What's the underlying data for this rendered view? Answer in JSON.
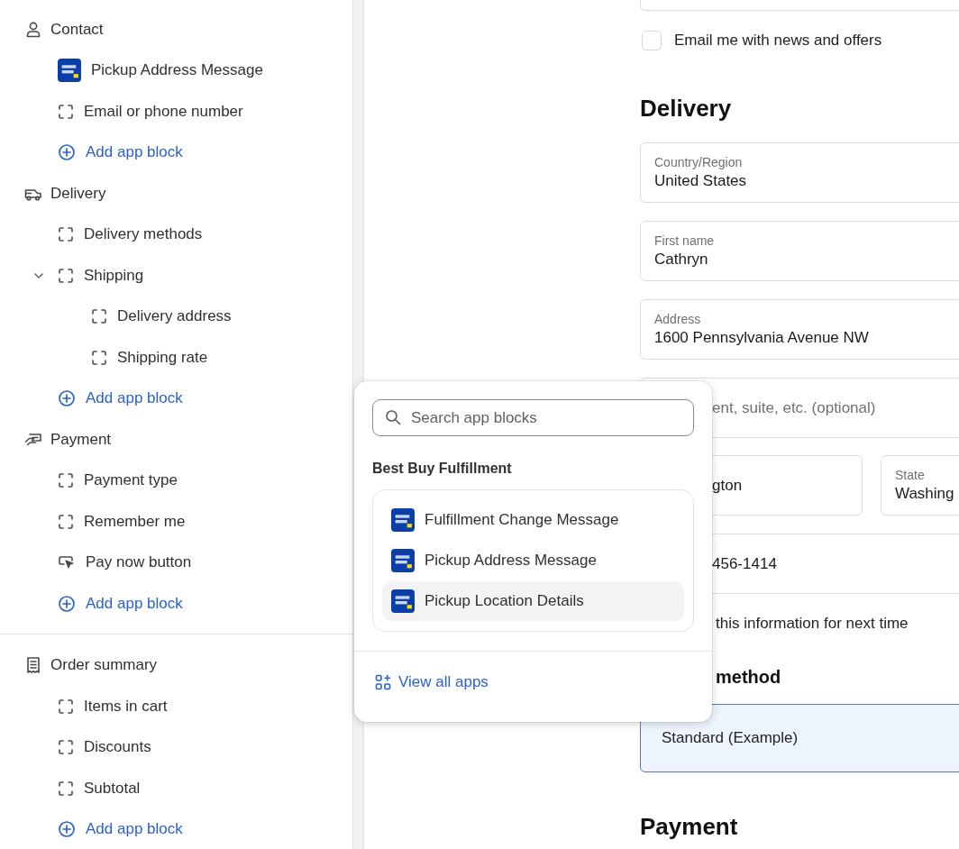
{
  "sidebar": {
    "groups": [
      {
        "sections": [
          {
            "label": "Contact",
            "children": [
              {
                "kind": "app",
                "label": "Pickup Address Message"
              },
              {
                "kind": "block",
                "label": "Email or phone number"
              },
              {
                "kind": "add",
                "label": "Add app block"
              }
            ]
          },
          {
            "label": "Delivery",
            "children": [
              {
                "kind": "block",
                "label": "Delivery methods"
              },
              {
                "kind": "block",
                "label": "Shipping",
                "expanded": true,
                "children": [
                  {
                    "kind": "block",
                    "label": "Delivery address"
                  },
                  {
                    "kind": "block",
                    "label": "Shipping rate"
                  }
                ]
              },
              {
                "kind": "add",
                "label": "Add app block"
              }
            ]
          },
          {
            "label": "Payment",
            "children": [
              {
                "kind": "block",
                "label": "Payment type"
              },
              {
                "kind": "block",
                "label": "Remember me"
              },
              {
                "kind": "button",
                "label": "Pay now button"
              },
              {
                "kind": "add",
                "label": "Add app block"
              }
            ]
          }
        ]
      },
      {
        "sections": [
          {
            "label": "Order summary",
            "children": [
              {
                "kind": "block",
                "label": "Items in cart"
              },
              {
                "kind": "block",
                "label": "Discounts"
              },
              {
                "kind": "block",
                "label": "Subtotal"
              },
              {
                "kind": "add",
                "label": "Add app block"
              }
            ]
          }
        ]
      }
    ]
  },
  "preview": {
    "items": [
      {
        "kind": "field-edge"
      },
      {
        "kind": "checkbox",
        "label": "Email me with news and offers",
        "checked": false
      },
      {
        "kind": "heading",
        "text": "Delivery"
      },
      {
        "kind": "field",
        "label": "Country/Region",
        "value": "United States"
      },
      {
        "kind": "field",
        "label": "First name",
        "value": "Cathryn"
      },
      {
        "kind": "field",
        "label": "Address",
        "value": "1600 Pennsylvania Avenue NW"
      },
      {
        "kind": "field",
        "placeholder": "ent, suite, etc. (optional)"
      },
      {
        "kind": "pair",
        "fields": [
          {
            "value": "gton"
          },
          {
            "label": "State",
            "value": "Washing"
          }
        ]
      },
      {
        "kind": "field",
        "value": "456-1414"
      },
      {
        "kind": "note",
        "text": "this information for next time"
      },
      {
        "kind": "subheading",
        "text": "method"
      },
      {
        "kind": "option",
        "label": "Standard (Example)",
        "selected": true
      },
      {
        "kind": "heading",
        "text": "Payment"
      }
    ]
  },
  "popover": {
    "search": {
      "placeholder": "Search app blocks"
    },
    "group_title": "Best Buy Fulfillment",
    "items": [
      {
        "label": "Fulfillment Change Message",
        "highlighted": false
      },
      {
        "label": "Pickup Address Message",
        "highlighted": false
      },
      {
        "label": "Pickup Location Details",
        "highlighted": true
      }
    ],
    "footer_link": "View all apps"
  }
}
